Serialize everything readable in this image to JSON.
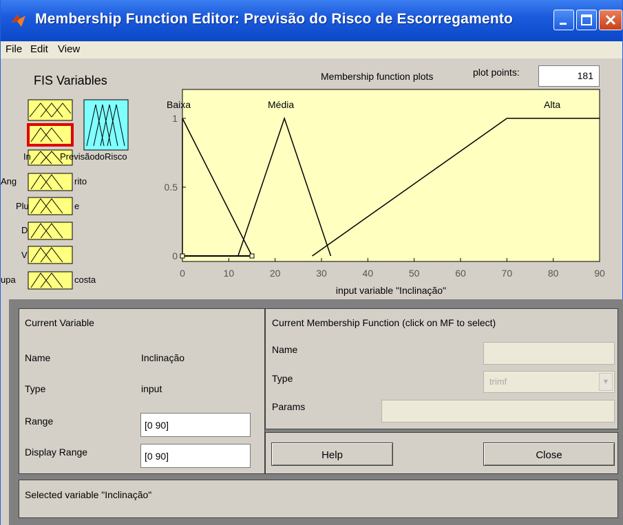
{
  "window": {
    "title": "Membership Function Editor: Previsão do Risco de Escorregamento",
    "menu": [
      "File",
      "Edit",
      "View"
    ]
  },
  "fis": {
    "label": "FIS Variables",
    "output_name": "PrevisãodoRisco",
    "input_label_fragments": [
      "In",
      "Ang",
      "rito",
      "Plu",
      "e",
      "D",
      "V",
      "upa",
      "costa"
    ]
  },
  "plot": {
    "title": "Membership function plots",
    "plot_points_label": "plot points:",
    "plot_points_value": "181",
    "xlabel": "input variable \"Inclinação\"",
    "mf_labels": [
      "Baixa",
      "Média",
      "Alta"
    ]
  },
  "chart_data": {
    "type": "line",
    "xlim": [
      0,
      90
    ],
    "ylim": [
      0,
      1
    ],
    "xticks": [
      0,
      10,
      20,
      30,
      40,
      50,
      60,
      70,
      80,
      90
    ],
    "yticks": [
      0,
      0.5,
      1
    ],
    "xlabel": "input variable \"Inclinação\"",
    "series": [
      {
        "name": "Baixa",
        "x": [
          0,
          0,
          15
        ],
        "y": [
          0,
          1,
          0
        ]
      },
      {
        "name": "Média",
        "x": [
          12,
          22,
          32
        ],
        "y": [
          0,
          1,
          0
        ]
      },
      {
        "name": "Alta",
        "x": [
          28,
          70,
          90
        ],
        "y": [
          0,
          1,
          1
        ]
      }
    ],
    "handle_line": {
      "x": [
        0,
        15
      ],
      "y": [
        0,
        0
      ]
    }
  },
  "current_variable": {
    "header": "Current Variable",
    "name_label": "Name",
    "name_value": "Inclinação",
    "type_label": "Type",
    "type_value": "input",
    "range_label": "Range",
    "range_value": "[0 90]",
    "display_range_label": "Display Range",
    "display_range_value": "[0 90]"
  },
  "current_mf": {
    "header": "Current Membership Function (click on MF to select)",
    "name_label": "Name",
    "type_label": "Type",
    "type_value": "trimf",
    "params_label": "Params"
  },
  "buttons": {
    "help": "Help",
    "close": "Close"
  },
  "status": "Selected variable \"Inclinação\"",
  "colors": {
    "titlebar": "#0a48c8",
    "plot_bg": "#ffffc0",
    "selected_border": "#e00000",
    "output_box": "#80ffff"
  }
}
